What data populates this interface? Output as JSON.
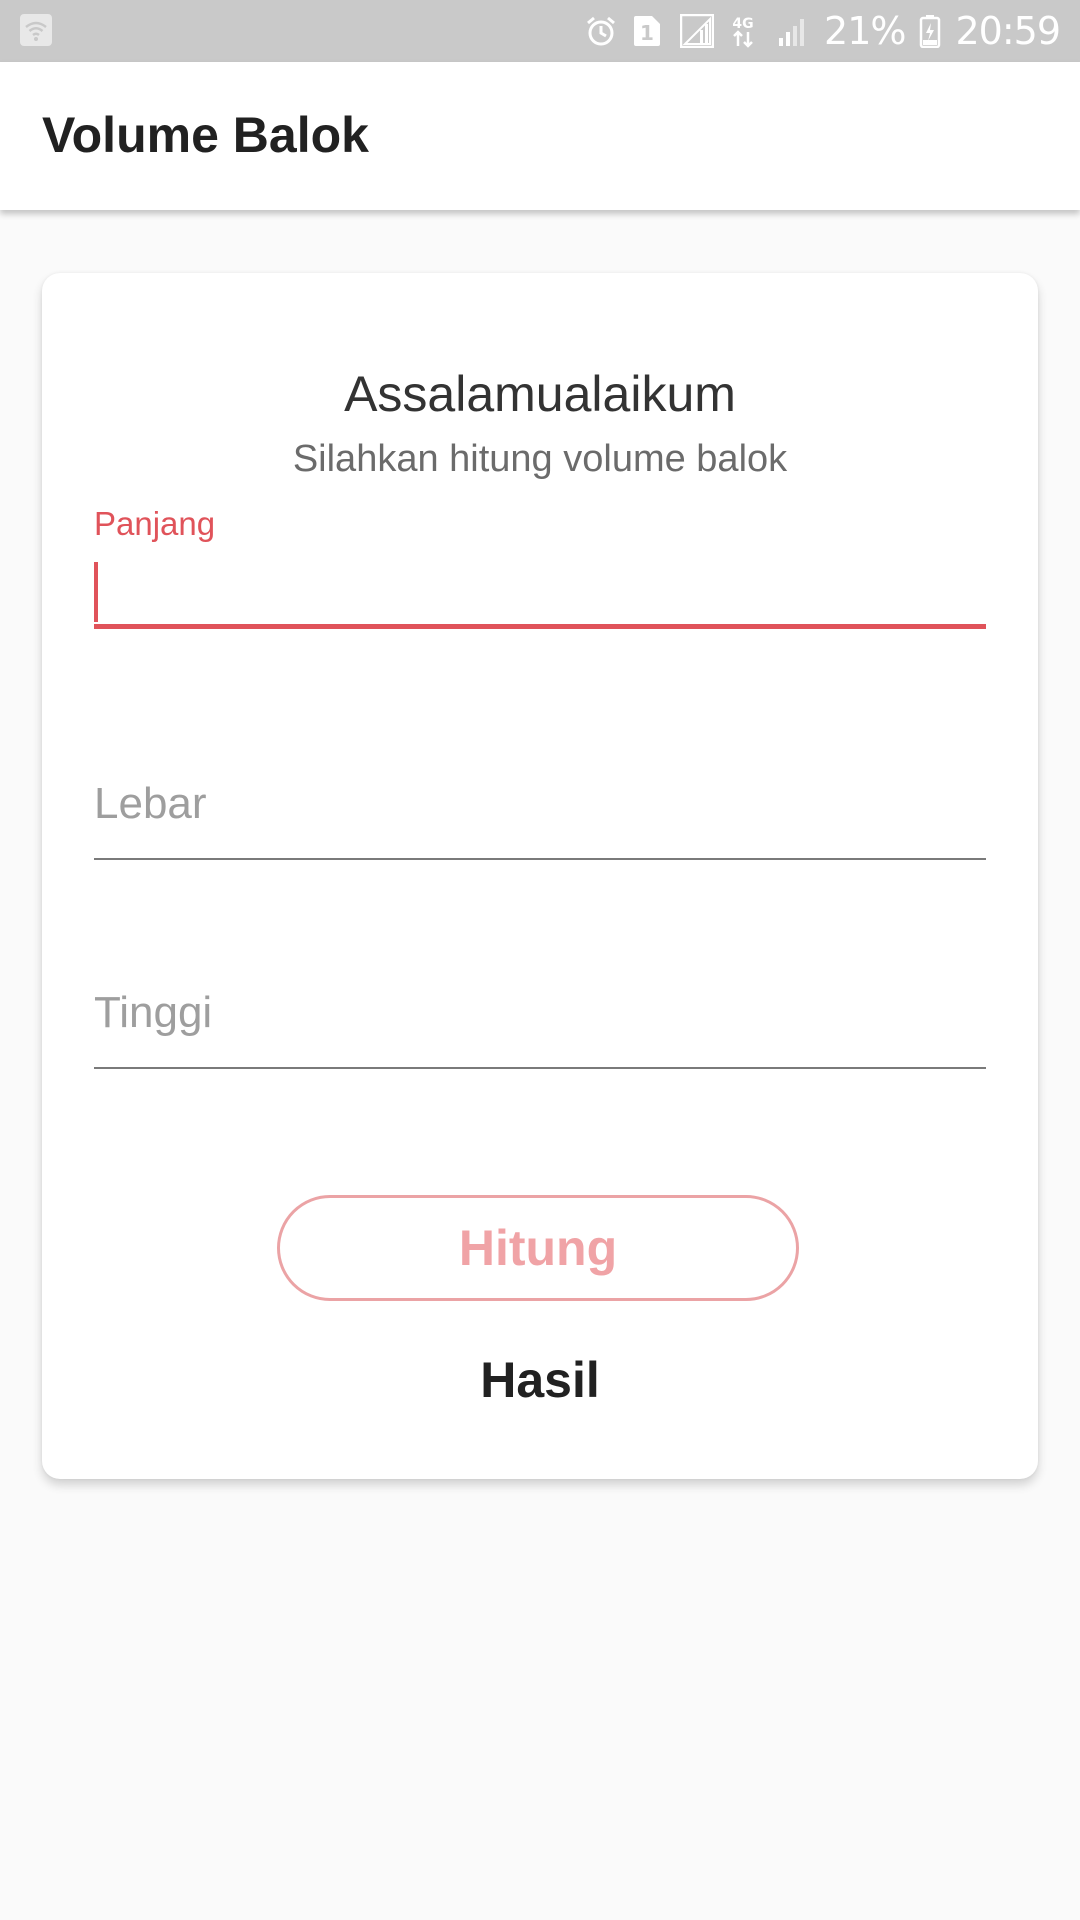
{
  "status_bar": {
    "battery": "21%",
    "time": "20:59",
    "sim_badge": "1",
    "network": "4G",
    "icons": [
      "wifi-icon",
      "alarm-icon",
      "sim-icon",
      "signal-icon",
      "network-4g-icon",
      "signal-icon",
      "battery-charging-icon"
    ]
  },
  "app_bar": {
    "title": "Volume Balok"
  },
  "card": {
    "greeting": "Assalamualaikum",
    "subtitle": "Silahkan hitung volume balok",
    "fields": {
      "panjang": {
        "label": "Panjang",
        "value": ""
      },
      "lebar": {
        "placeholder": "Lebar",
        "value": ""
      },
      "tinggi": {
        "placeholder": "Tinggi",
        "value": ""
      }
    },
    "button_label": "Hitung",
    "result_label": "Hasil"
  },
  "colors": {
    "accent": "#e0535a",
    "button_text": "#f0a3a6",
    "button_border": "#eba3a5",
    "status_bar_bg": "#c9c9c9",
    "background": "#fafafa"
  }
}
